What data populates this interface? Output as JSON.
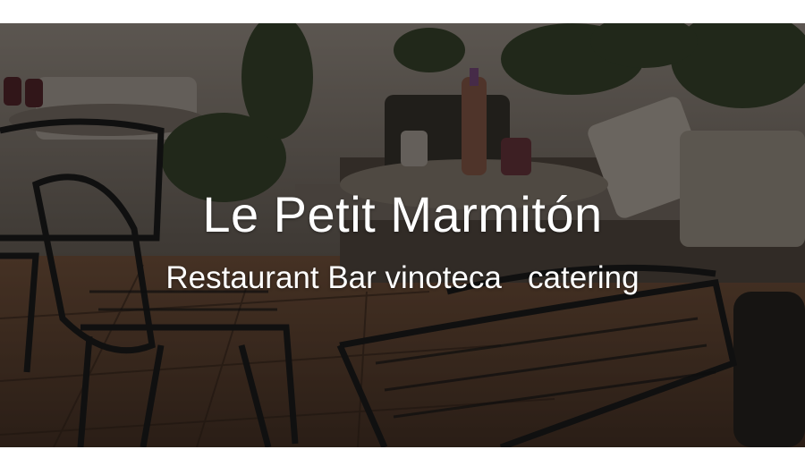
{
  "hero": {
    "title": "Le Petit Marmitón",
    "subtitle": "Restaurant Bar vinoteca   catering",
    "image_description_icon": "restaurant-terrace-photo"
  },
  "colors": {
    "page_background": "#ffffff",
    "text": "#ffffff"
  }
}
